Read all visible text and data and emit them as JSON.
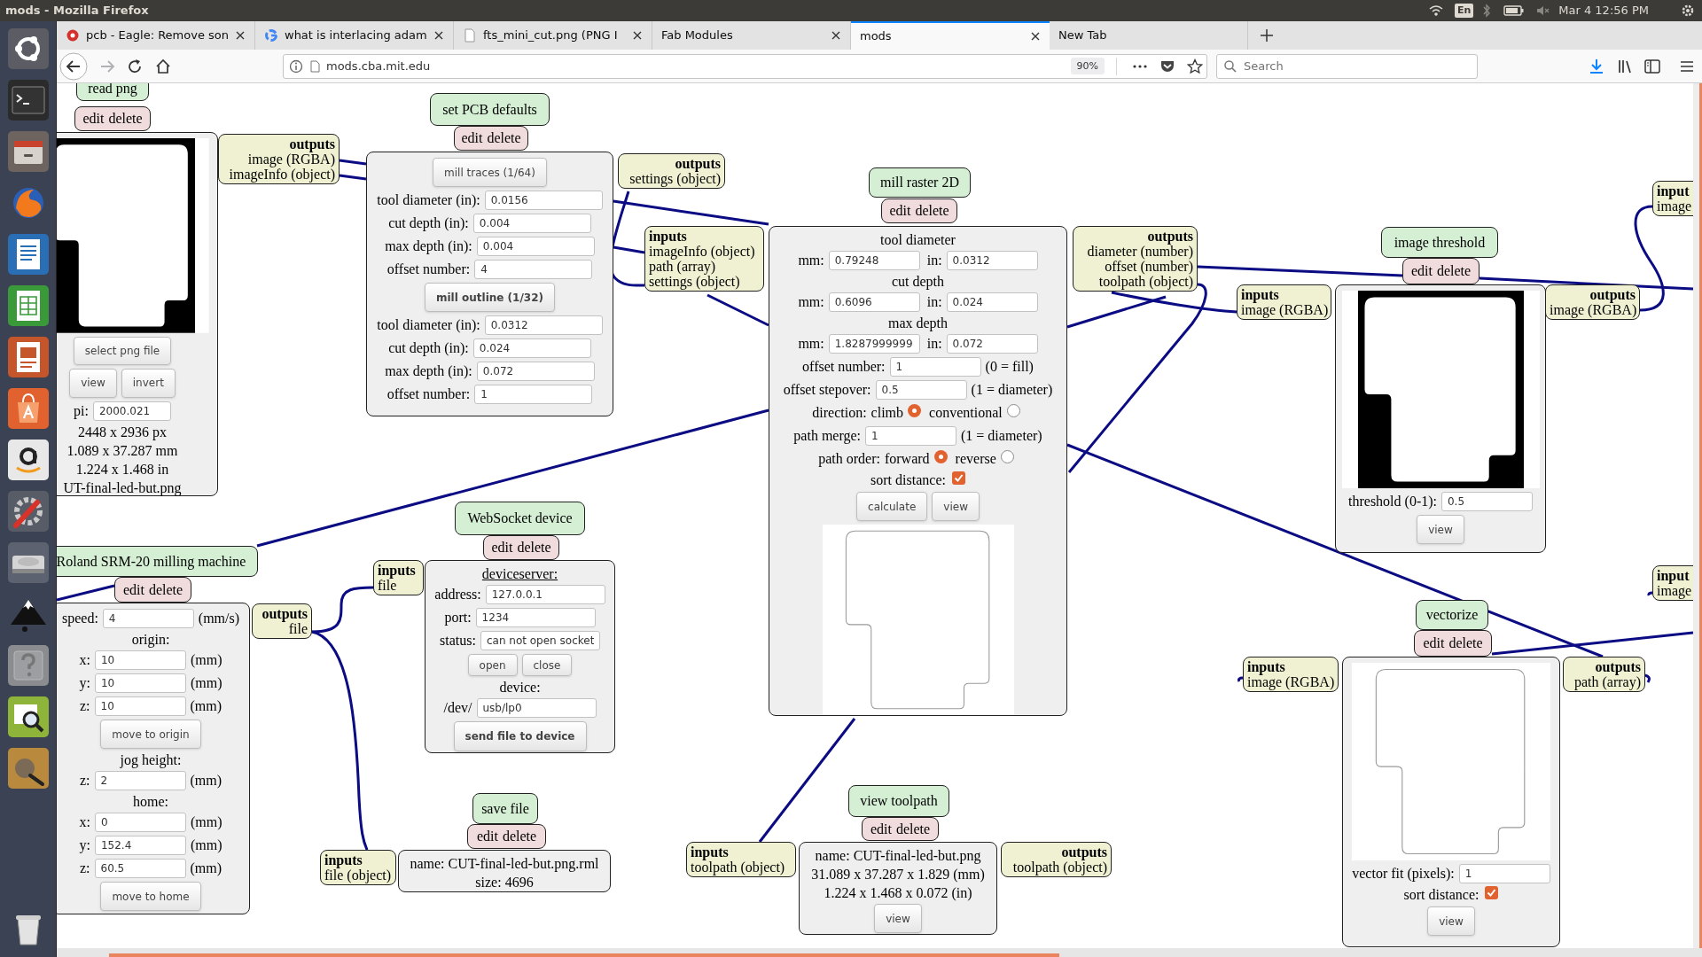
{
  "os_bar": {
    "title": "mods - Mozilla Firefox",
    "keyboard": "En",
    "clock": "Mar 4 12:56 PM"
  },
  "tabs": [
    {
      "label": "pcb - Eagle: Remove son",
      "kind": "eagle",
      "selected": false,
      "closable": true
    },
    {
      "label": "what is interlacing adam",
      "kind": "google",
      "selected": false,
      "closable": true
    },
    {
      "label": "fts_mini_cut.png (PNG I",
      "kind": "page",
      "selected": false,
      "closable": true
    },
    {
      "label": "Fab Modules",
      "kind": "plain",
      "selected": false,
      "closable": true
    },
    {
      "label": "mods",
      "kind": "plain",
      "selected": true,
      "closable": true
    },
    {
      "label": "New Tab",
      "kind": "plain",
      "selected": false,
      "closable": false
    }
  ],
  "address": {
    "url": "mods.cba.mit.edu",
    "zoom": "90%"
  },
  "search": {
    "placeholder": "Search"
  },
  "modules": [
    {
      "title": "read png",
      "actions": [
        "edit",
        "delete"
      ],
      "outputs": {
        "label": "outputs",
        "ports": [
          "image (RGBA)",
          "imageInfo (object)"
        ]
      },
      "body": [
        {
          "kind": "bitmap"
        },
        {
          "kind": "button",
          "label": "select png file",
          "bold": false
        },
        {
          "kind": "buttons",
          "buttons": [
            {
              "label": "view"
            },
            {
              "label": "invert"
            }
          ]
        },
        {
          "kind": "field",
          "label": "pi:",
          "value": "2000.021"
        },
        {
          "kind": "text",
          "text": "2448 x 2936 px"
        },
        {
          "kind": "text",
          "text": "1.089 x 37.287 mm"
        },
        {
          "kind": "text",
          "text": "1.224 x 1.468 in"
        },
        {
          "kind": "text",
          "text": "UT-final-led-but.png"
        }
      ]
    },
    {
      "title": "set PCB defaults",
      "actions": [
        "edit",
        "delete"
      ],
      "outputs": {
        "label": "outputs",
        "ports": [
          "settings (object)"
        ]
      },
      "body": [
        {
          "kind": "button",
          "label": "mill traces (1/64)",
          "bold": false
        },
        {
          "kind": "field",
          "label": "tool diameter (in):",
          "value": "0.0156"
        },
        {
          "kind": "field",
          "label": "cut depth (in):",
          "value": "0.004"
        },
        {
          "kind": "field",
          "label": "max depth (in):",
          "value": "0.004"
        },
        {
          "kind": "field",
          "label": "offset number:",
          "value": "4"
        },
        {
          "kind": "button",
          "label": "mill outline (1/32)",
          "bold": true
        },
        {
          "kind": "field",
          "label": "tool diameter (in):",
          "value": "0.0312"
        },
        {
          "kind": "field",
          "label": "cut depth (in):",
          "value": "0.024"
        },
        {
          "kind": "field",
          "label": "max depth (in):",
          "value": "0.072"
        },
        {
          "kind": "field",
          "label": "offset number:",
          "value": "1"
        }
      ]
    },
    {
      "title": "mill raster 2D",
      "actions": [
        "edit",
        "delete"
      ],
      "inputs": {
        "label": "inputs",
        "ports": [
          "imageInfo (object)",
          "path (array)",
          "settings (object)"
        ]
      },
      "outputs": {
        "label": "outputs",
        "ports": [
          "diameter (number)",
          "offset (number)",
          "toolpath (object)"
        ]
      },
      "body": [
        {
          "kind": "text",
          "text": "tool diameter"
        },
        {
          "kind": "pair",
          "fields": [
            {
              "label": "mm:",
              "value": "0.79248"
            },
            {
              "label": "in:",
              "value": "0.0312"
            }
          ]
        },
        {
          "kind": "text",
          "text": "cut depth"
        },
        {
          "kind": "pair",
          "fields": [
            {
              "label": "mm:",
              "value": "0.6096"
            },
            {
              "label": "in:",
              "value": "0.024"
            }
          ]
        },
        {
          "kind": "text",
          "text": "max depth"
        },
        {
          "kind": "pair",
          "fields": [
            {
              "label": "mm:",
              "value": "1.8287999999"
            },
            {
              "label": "in:",
              "value": "0.072"
            }
          ]
        },
        {
          "kind": "field",
          "label": "offset number:",
          "value": "1",
          "unit": "(0 = fill)"
        },
        {
          "kind": "field",
          "label": "offset stepover:",
          "value": "0.5",
          "unit": "(1 = diameter)"
        },
        {
          "kind": "radio",
          "label": "direction:",
          "options": [
            {
              "label": "climb",
              "selected": true
            },
            {
              "label": "conventional",
              "selected": false
            }
          ]
        },
        {
          "kind": "field",
          "label": "path merge:",
          "value": "1",
          "unit": "(1 = diameter)"
        },
        {
          "kind": "radio",
          "label": "path order:",
          "options": [
            {
              "label": "forward",
              "selected": true
            },
            {
              "label": "reverse",
              "selected": false
            }
          ]
        },
        {
          "kind": "check",
          "label": "sort distance:",
          "checked": true
        },
        {
          "kind": "buttons",
          "buttons": [
            {
              "label": "calculate"
            },
            {
              "label": "view"
            }
          ]
        },
        {
          "kind": "outline"
        }
      ]
    },
    {
      "title": "image threshold",
      "actions": [
        "edit",
        "delete"
      ],
      "inputs": {
        "label": "inputs",
        "ports": [
          "image (RGBA)"
        ]
      },
      "outputs": {
        "label": "outputs",
        "ports": [
          "image (RGBA)"
        ]
      },
      "body": [
        {
          "kind": "bitmap"
        },
        {
          "kind": "field",
          "label": "threshold (0-1):",
          "value": "0.5"
        },
        {
          "kind": "button",
          "label": "view",
          "bold": false
        }
      ]
    },
    {
      "inputs": {
        "label": "input",
        "ports": [
          "image"
        ]
      }
    },
    {
      "title": "Roland SRM-20 milling machine",
      "actions": [
        "edit",
        "delete"
      ],
      "outputs": {
        "label": "outputs",
        "ports": [
          "file"
        ]
      },
      "body": [
        {
          "kind": "field",
          "label": "speed:",
          "value": "4",
          "unit": "(mm/s)"
        },
        {
          "kind": "text",
          "text": "origin:"
        },
        {
          "kind": "field",
          "label": "x:",
          "value": "10",
          "unit": "(mm)"
        },
        {
          "kind": "field",
          "label": "y:",
          "value": "10",
          "unit": "(mm)"
        },
        {
          "kind": "field",
          "label": "z:",
          "value": "10",
          "unit": "(mm)"
        },
        {
          "kind": "button",
          "label": "move to origin",
          "bold": false
        },
        {
          "kind": "text",
          "text": "jog height:"
        },
        {
          "kind": "field",
          "label": "z:",
          "value": "2",
          "unit": "(mm)"
        },
        {
          "kind": "text",
          "text": "home:"
        },
        {
          "kind": "field",
          "label": "x:",
          "value": "0",
          "unit": "(mm)"
        },
        {
          "kind": "field",
          "label": "y:",
          "value": "152.4",
          "unit": "(mm)"
        },
        {
          "kind": "field",
          "label": "z:",
          "value": "60.5",
          "unit": "(mm)"
        },
        {
          "kind": "button",
          "label": "move to home",
          "bold": false
        }
      ]
    },
    {
      "title": "WebSocket device",
      "actions": [
        "edit",
        "delete"
      ],
      "inputs": {
        "label": "inputs",
        "ports": [
          "file"
        ]
      },
      "body": [
        {
          "kind": "heading",
          "text": "deviceserver:"
        },
        {
          "kind": "field",
          "label": "address:",
          "value": "127.0.0.1"
        },
        {
          "kind": "field",
          "label": "port:",
          "value": "1234"
        },
        {
          "kind": "field",
          "label": "status:",
          "value": "can not open socket"
        },
        {
          "kind": "buttons",
          "buttons": [
            {
              "label": "open"
            },
            {
              "label": "close"
            }
          ]
        },
        {
          "kind": "text",
          "text": "device:"
        },
        {
          "kind": "field",
          "label": "/dev/",
          "value": "usb/lp0"
        },
        {
          "kind": "button",
          "label": "send file to device",
          "bold": true
        }
      ]
    },
    {
      "title": "vectorize",
      "actions": [
        "edit",
        "delete"
      ],
      "inputs": {
        "label": "inputs",
        "ports": [
          "image (RGBA)"
        ]
      },
      "outputs": {
        "label": "outputs",
        "ports": [
          "path (array)"
        ]
      },
      "body": [
        {
          "kind": "outline"
        },
        {
          "kind": "field",
          "label": "vector fit (pixels):",
          "value": "1"
        },
        {
          "kind": "check",
          "label": "sort distance:",
          "checked": true
        },
        {
          "kind": "button",
          "label": "view",
          "bold": false
        }
      ]
    },
    {
      "inputs": {
        "label": "input",
        "ports": [
          "image"
        ]
      }
    },
    {
      "title": "save file",
      "actions": [
        "edit",
        "delete"
      ],
      "inputs": {
        "label": "inputs",
        "ports": [
          "file (object)"
        ]
      },
      "body": [
        {
          "kind": "text",
          "text": "name: CUT-final-led-but.png.rml"
        },
        {
          "kind": "text",
          "text": "size: 4696"
        }
      ]
    },
    {
      "title": "view toolpath",
      "actions": [
        "edit",
        "delete"
      ],
      "inputs": {
        "label": "inputs",
        "ports": [
          "toolpath (object)"
        ]
      },
      "outputs": {
        "label": "outputs",
        "ports": [
          "toolpath (object)"
        ]
      },
      "body": [
        {
          "kind": "text",
          "text": "name: CUT-final-led-but.png"
        },
        {
          "kind": "text",
          "text": "31.089 x 37.287 x 1.829 (mm)"
        },
        {
          "kind": "text",
          "text": "1.224 x 1.468 x 0.072 (in)"
        },
        {
          "kind": "button",
          "label": "view",
          "bold": false
        }
      ]
    }
  ]
}
